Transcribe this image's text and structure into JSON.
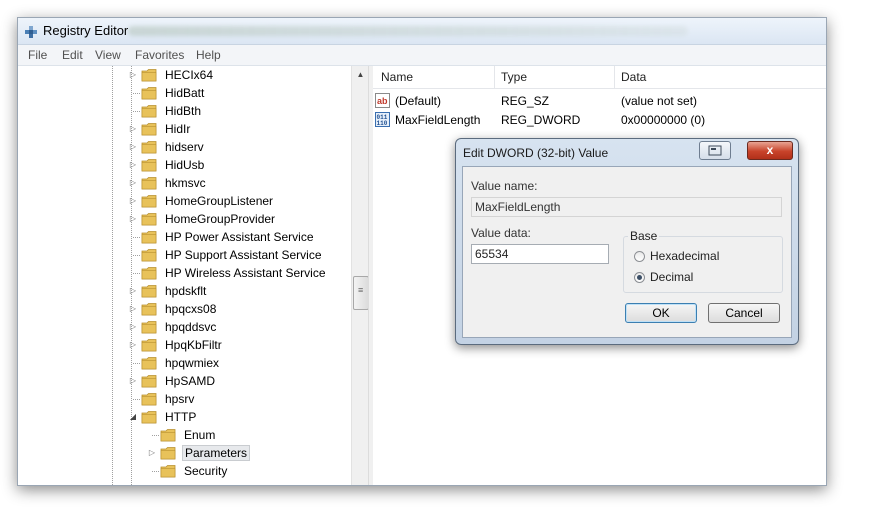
{
  "window": {
    "title": "Registry Editor"
  },
  "menu": [
    "File",
    "Edit",
    "View",
    "Favorites",
    "Help"
  ],
  "tree": {
    "items": [
      {
        "label": "HECIx64",
        "expander": "closed"
      },
      {
        "label": "HidBatt",
        "expander": "none"
      },
      {
        "label": "HidBth",
        "expander": "none"
      },
      {
        "label": "HidIr",
        "expander": "closed"
      },
      {
        "label": "hidserv",
        "expander": "closed"
      },
      {
        "label": "HidUsb",
        "expander": "closed"
      },
      {
        "label": "hkmsvc",
        "expander": "closed"
      },
      {
        "label": "HomeGroupListener",
        "expander": "closed"
      },
      {
        "label": "HomeGroupProvider",
        "expander": "closed"
      },
      {
        "label": "HP Power Assistant Service",
        "expander": "none"
      },
      {
        "label": "HP Support Assistant Service",
        "expander": "none"
      },
      {
        "label": "HP Wireless Assistant Service",
        "expander": "none"
      },
      {
        "label": "hpdskflt",
        "expander": "closed"
      },
      {
        "label": "hpqcxs08",
        "expander": "closed"
      },
      {
        "label": "hpqddsvc",
        "expander": "closed"
      },
      {
        "label": "HpqKbFiltr",
        "expander": "closed"
      },
      {
        "label": "hpqwmiex",
        "expander": "none"
      },
      {
        "label": "HpSAMD",
        "expander": "closed"
      },
      {
        "label": "hpsrv",
        "expander": "none"
      },
      {
        "label": "HTTP",
        "expander": "open"
      }
    ],
    "children": [
      {
        "label": "Enum",
        "expander": "none",
        "selected": false
      },
      {
        "label": "Parameters",
        "expander": "closed",
        "selected": true
      },
      {
        "label": "Security",
        "expander": "none",
        "selected": false
      }
    ]
  },
  "list": {
    "columns": [
      "Name",
      "Type",
      "Data"
    ],
    "rows": [
      {
        "icon": "string-value-icon",
        "name": "(Default)",
        "type": "REG_SZ",
        "data": "(value not set)"
      },
      {
        "icon": "dword-value-icon",
        "name": "MaxFieldLength",
        "type": "REG_DWORD",
        "data": "0x00000000 (0)"
      }
    ]
  },
  "dialog": {
    "title": "Edit DWORD (32-bit) Value",
    "value_name_label": "Value name:",
    "value_name": "MaxFieldLength",
    "value_data_label": "Value data:",
    "value_data": "65534",
    "base_label": "Base",
    "hex_label": "Hexadecimal",
    "dec_label": "Decimal",
    "selected_base": "Decimal",
    "ok_label": "OK",
    "cancel_label": "Cancel",
    "close_glyph": "x"
  },
  "colors": {
    "folder": "#e8c25a",
    "accent": "#3c7fb1",
    "close": "#c8432a"
  }
}
